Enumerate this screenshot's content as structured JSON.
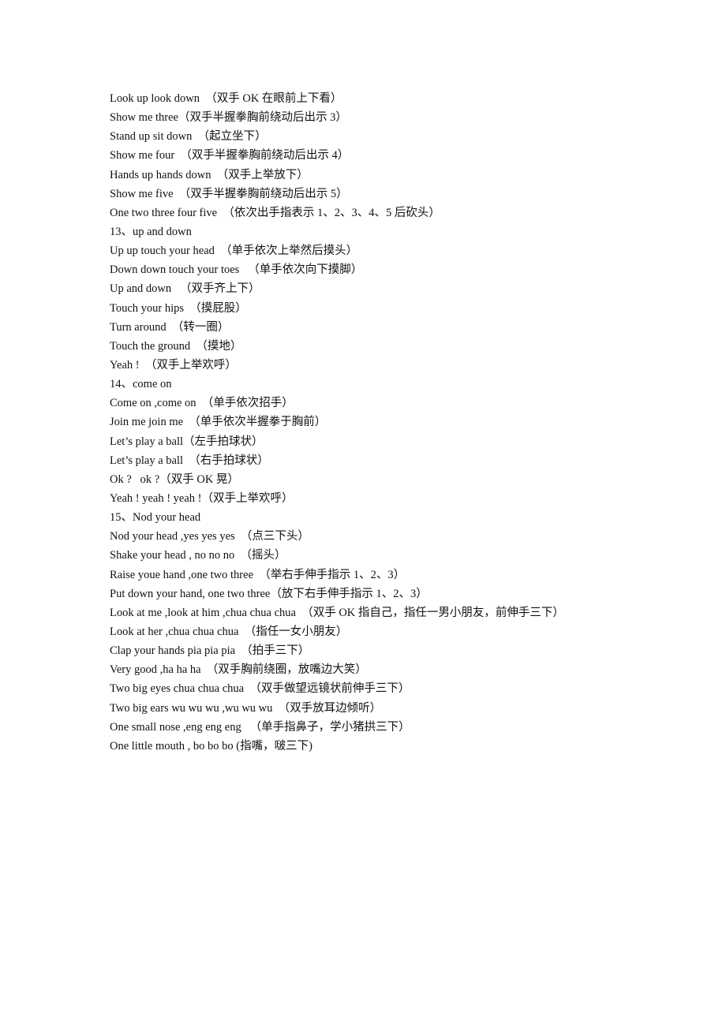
{
  "document": {
    "lines": [
      "Look up look down  （双手 OK 在眼前上下看）",
      "Show me three（双手半握拳胸前绕动后出示 3）",
      "Stand up sit down  （起立坐下）",
      "Show me four  （双手半握拳胸前绕动后出示 4）",
      "Hands up hands down  （双手上举放下）",
      "Show me five  （双手半握拳胸前绕动后出示 5）",
      "One two three four five  （依次出手指表示 1、2、3、4、5 后砍头）",
      "13、up and down",
      "Up up touch your head  （单手依次上举然后摸头）",
      "Down down touch your toes   （单手依次向下摸脚）",
      "Up and down   （双手齐上下）",
      "Touch your hips  （摸屁股）",
      "Turn around  （转一圈）",
      "Touch the ground  （摸地）",
      "Yeah !  （双手上举欢呼）",
      "14、come on",
      "Come on ,come on  （单手依次招手）",
      "Join me join me  （单手依次半握拳于胸前）",
      "Let’s play a ball（左手拍球状）",
      "Let’s play a ball  （右手拍球状）",
      "Ok ?   ok ?（双手 OK 晃）",
      "Yeah ! yeah ! yeah !（双手上举欢呼）",
      "15、Nod your head",
      "Nod your head ,yes yes yes  （点三下头）",
      "Shake your head , no no no  （摇头）",
      "Raise youe hand ,one two three  （举右手伸手指示 1、2、3）",
      "Put down your hand, one two three（放下右手伸手指示 1、2、3）",
      "Look at me ,look at him ,chua chua chua  （双手 OK 指自己，指任一男小朋友，前伸手三下）",
      "Look at her ,chua chua chua  （指任一女小朋友）",
      "Clap your hands pia pia pia  （拍手三下）",
      "Very good ,ha ha ha  （双手胸前绕圈，放嘴边大笑）",
      "Two big eyes chua chua chua  （双手做望远镜状前伸手三下）",
      "Two big ears wu wu wu ,wu wu wu  （双手放耳边倾听）",
      "One small nose ,eng eng eng   （单手指鼻子，学小猪拱三下）",
      "One little mouth , bo bo bo (指嘴，啵三下)"
    ]
  }
}
